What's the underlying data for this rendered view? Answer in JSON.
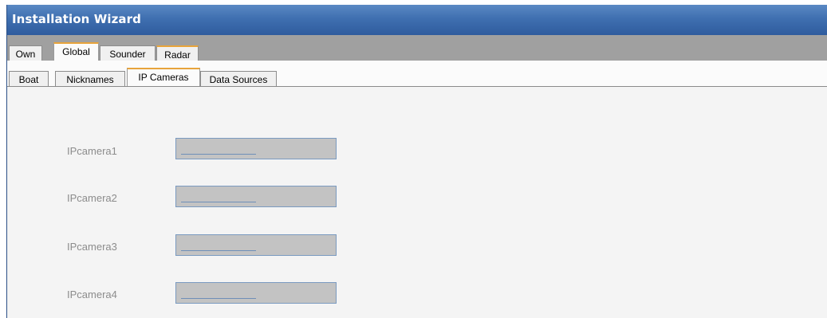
{
  "window": {
    "title": "Installation Wizard"
  },
  "outer_tabs": [
    {
      "label": "Own",
      "selected": false
    },
    {
      "label": "Global",
      "selected": true
    },
    {
      "label": "Sounder",
      "selected": false
    },
    {
      "label": "Radar",
      "selected": false
    }
  ],
  "inner_tabs": [
    {
      "label": "Boat",
      "selected": false
    },
    {
      "label": "Nicknames",
      "selected": false
    },
    {
      "label": "IP Cameras",
      "selected": true
    },
    {
      "label": "Data Sources",
      "selected": false
    }
  ],
  "cameras": [
    {
      "label": "IPcamera1",
      "value": ""
    },
    {
      "label": "IPcamera2",
      "value": ""
    },
    {
      "label": "IPcamera3",
      "value": ""
    },
    {
      "label": "IPcamera4",
      "value": ""
    }
  ],
  "colors": {
    "titlebar": "#3f6fb0",
    "tab_highlight": "#e8a43b",
    "field_fill": "#c3c3c3",
    "label_text": "#8c8c8c"
  }
}
